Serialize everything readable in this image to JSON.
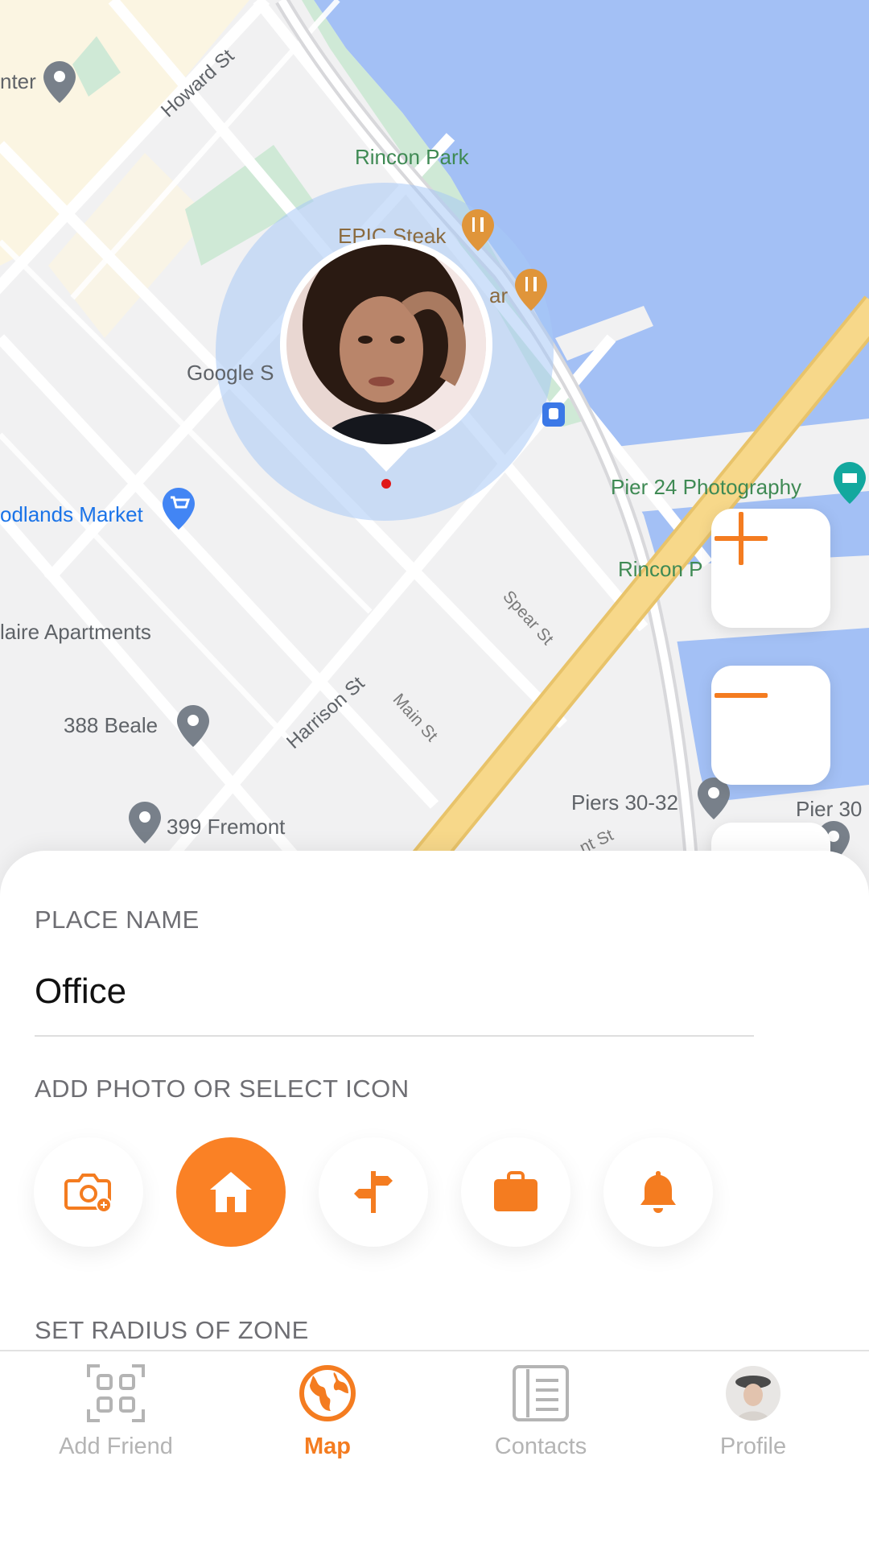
{
  "map": {
    "labels": {
      "howard_st": "Howard St",
      "rincon_park": "Rincon Park",
      "epic_steak": "EPIC Steak",
      "bar_partial": "ar",
      "google_partial": "Google S",
      "pier24": "Pier 24 Photography",
      "rincon_partial": "Rincon P",
      "woodlands": "odlands Market",
      "spear_st": "Spear St",
      "apartments": "laire Apartments",
      "harrison_st": "Harrison St",
      "main_st": "Main St",
      "beale": "388 Beale",
      "fremont": "399 Fremont",
      "piers3032": "Piers 30-32",
      "pier30": "Pier 30",
      "st_partial": "nt St",
      "center_partial": "nter"
    },
    "colors": {
      "water": "#a3c0f5",
      "land": "#f1f1f2",
      "park": "#cfe9d6",
      "highway": "#f7d88a",
      "accent": "#f47c20",
      "radius": "#a8c8f5"
    }
  },
  "zoom": {
    "in_icon": "plus-icon",
    "out_icon": "minus-icon"
  },
  "sheet": {
    "place_name_label": "PLACE NAME",
    "place_name_value": "Office",
    "icon_section_label": "ADD PHOTO OR SELECT ICON",
    "icons": [
      "camera-plus-icon",
      "home-icon",
      "signpost-icon",
      "briefcase-icon",
      "bell-icon"
    ],
    "selected_icon": "home-icon",
    "radius_label": "SET RADIUS OF ZONE"
  },
  "tabs": [
    {
      "label": "Add Friend",
      "icon": "qr-code-icon"
    },
    {
      "label": "Map",
      "icon": "globe-icon",
      "active": true
    },
    {
      "label": "Contacts",
      "icon": "contacts-icon"
    },
    {
      "label": "Profile",
      "icon": "avatar"
    }
  ]
}
